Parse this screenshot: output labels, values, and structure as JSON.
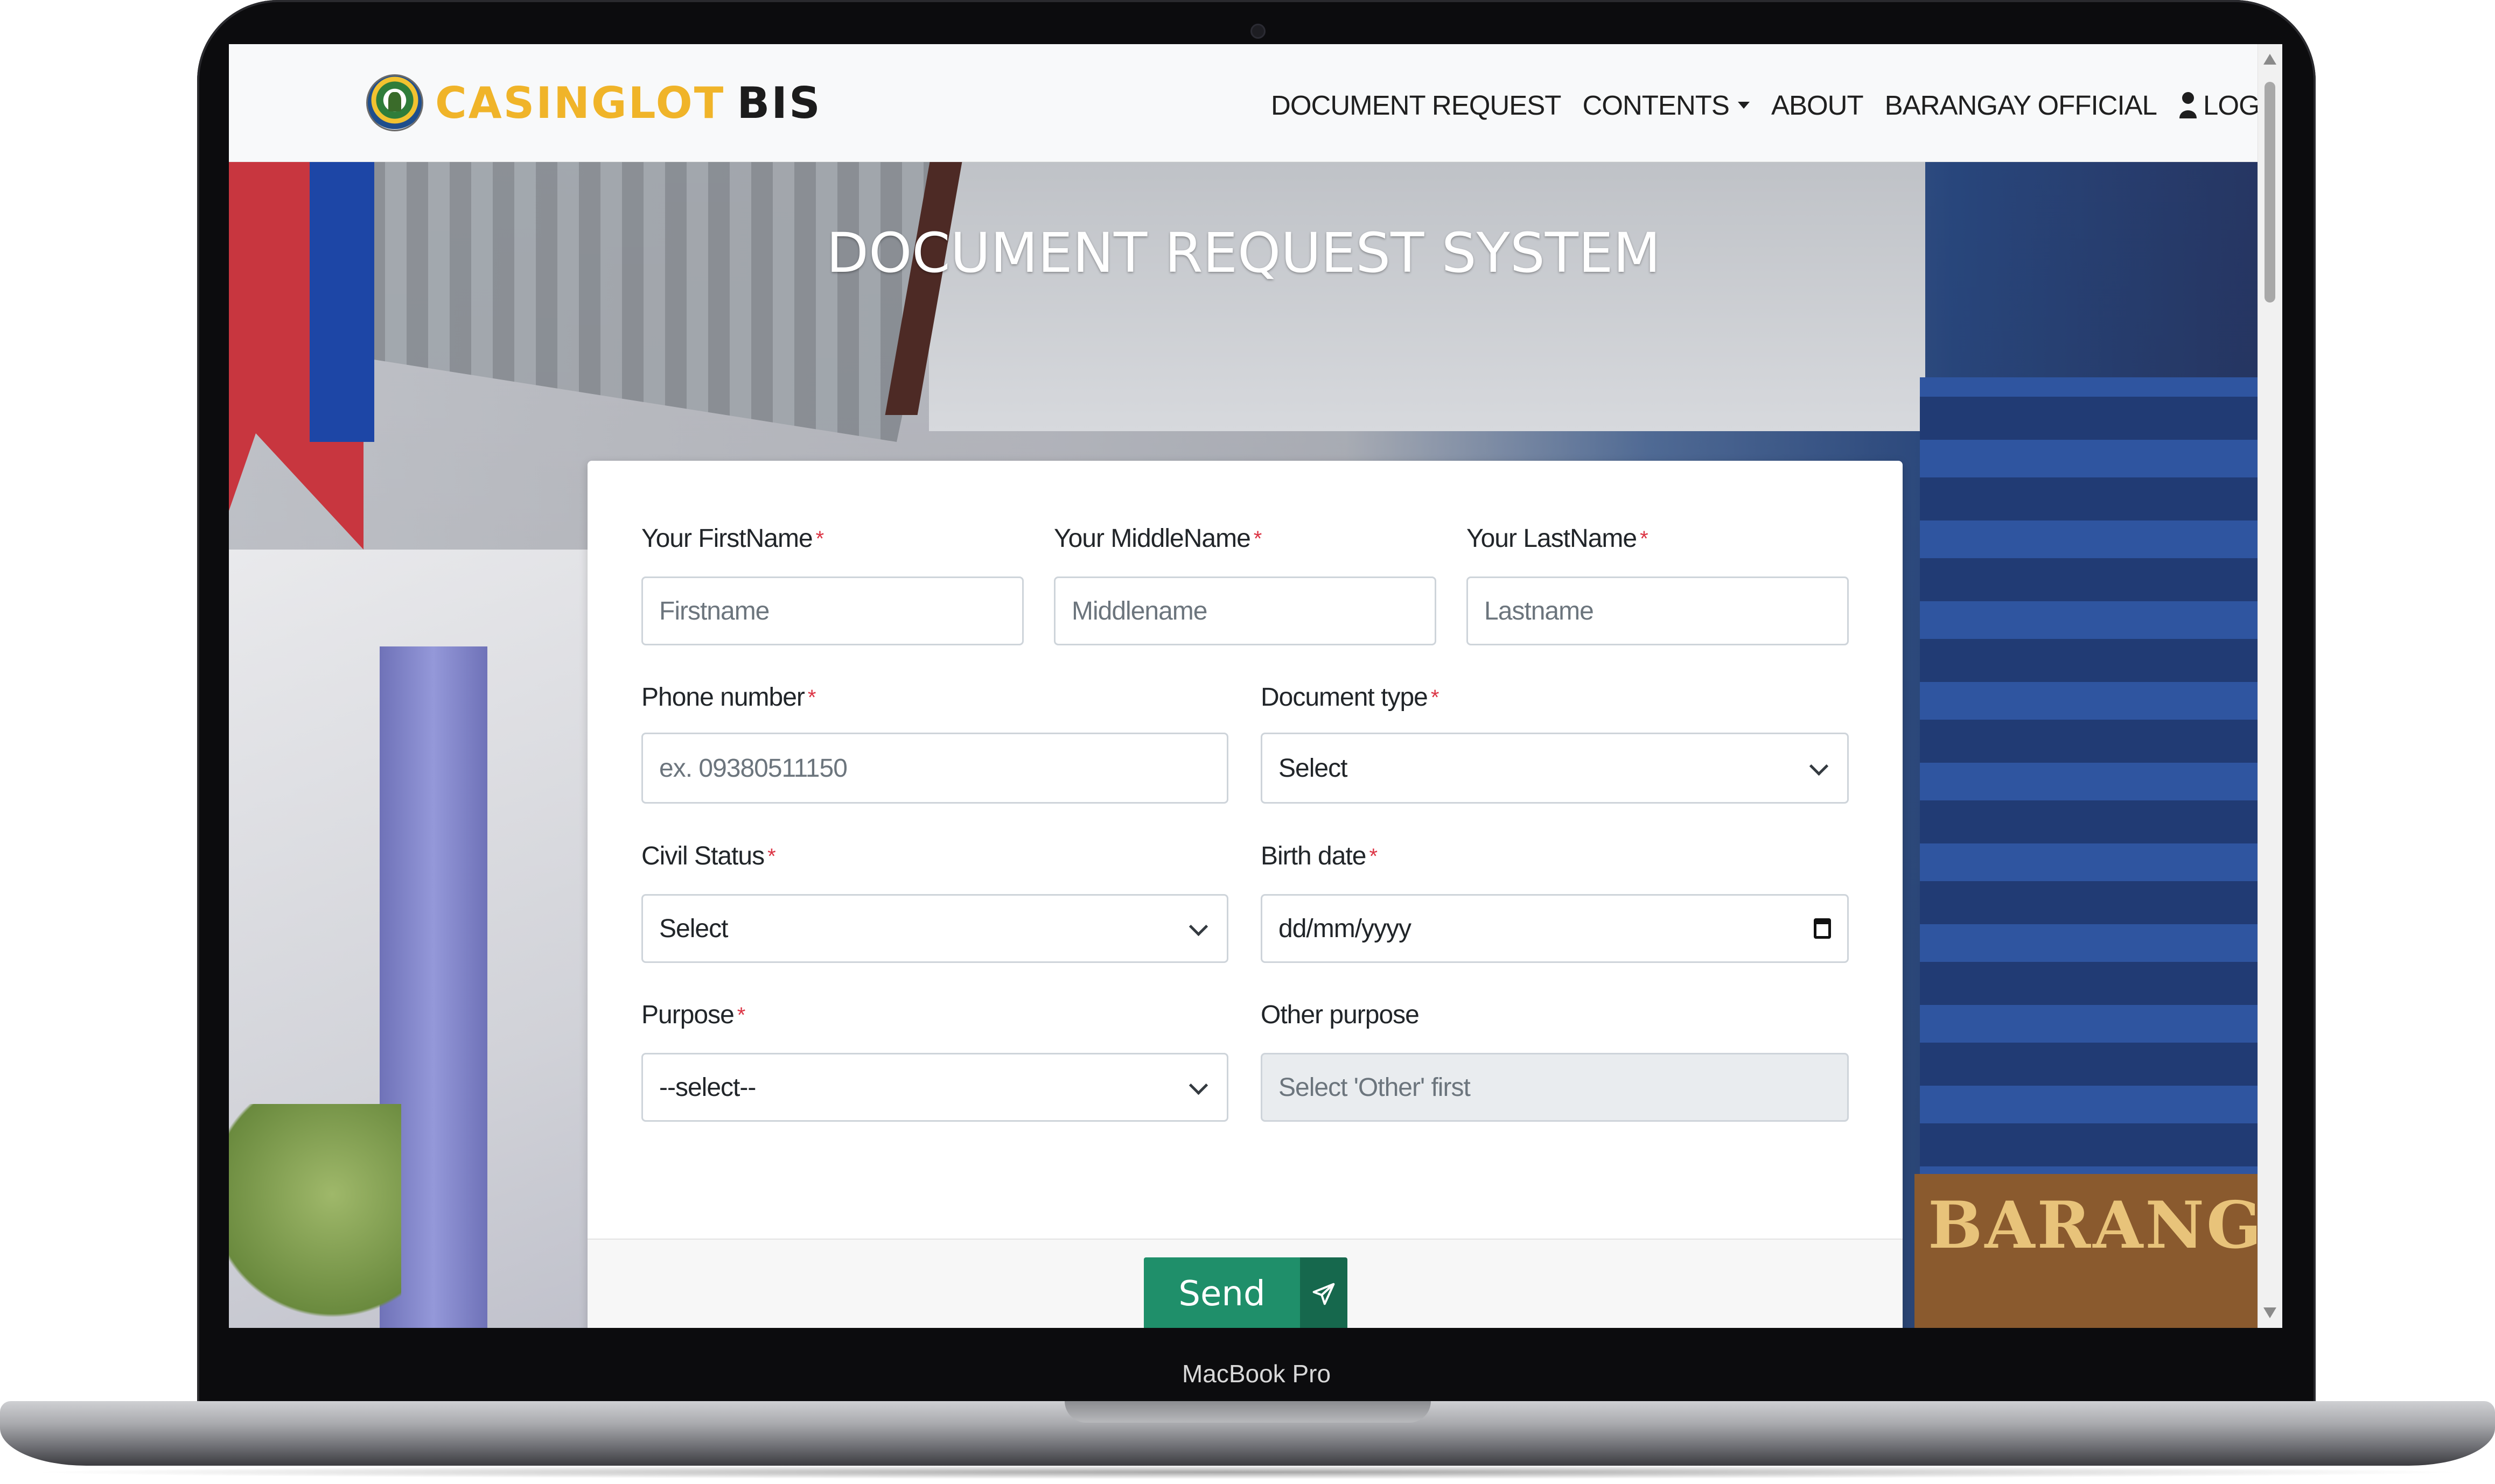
{
  "device": {
    "label": "MacBook Pro"
  },
  "navbar": {
    "brand_name": "CASINGLOT",
    "brand_suffix": "BIS",
    "links": {
      "document_request": "DOCUMENT REQUEST",
      "contents": "CONTENTS",
      "about": "ABOUT",
      "barangay_official": "BARANGAY OFFICIAL",
      "login": "LOGIN"
    }
  },
  "hero": {
    "title": "DOCUMENT REQUEST SYSTEM",
    "sign_text": "BARANGAY"
  },
  "form": {
    "firstname": {
      "label": "Your FirstName",
      "placeholder": "Firstname",
      "required": "*"
    },
    "middlename": {
      "label": "Your MiddleName",
      "placeholder": "Middlename",
      "required": "*"
    },
    "lastname": {
      "label": "Your LastName",
      "placeholder": "Lastname",
      "required": "*"
    },
    "phone": {
      "label": "Phone number",
      "placeholder": "ex. 09380511150",
      "required": "*"
    },
    "document_type": {
      "label": "Document type",
      "value": "Select",
      "required": "*"
    },
    "civil_status": {
      "label": "Civil Status",
      "value": "Select",
      "required": "*"
    },
    "birth_date": {
      "label": "Birth date",
      "value": "dd/mm/yyyy",
      "required": "*"
    },
    "purpose": {
      "label": "Purpose",
      "value": "--select--",
      "required": "*"
    },
    "other_purpose": {
      "label": "Other purpose",
      "placeholder": "Select 'Other' first"
    },
    "submit_label": "Send"
  },
  "colors": {
    "brand_accent": "#f0b429",
    "send_button": "#1f8f6a",
    "send_icon_bg": "#16684d",
    "required_mark": "#dc3545"
  },
  "icons": {
    "user": "user-icon",
    "send": "paper-plane-icon",
    "calendar": "calendar-icon",
    "dropdown": "chevron-down-icon"
  }
}
